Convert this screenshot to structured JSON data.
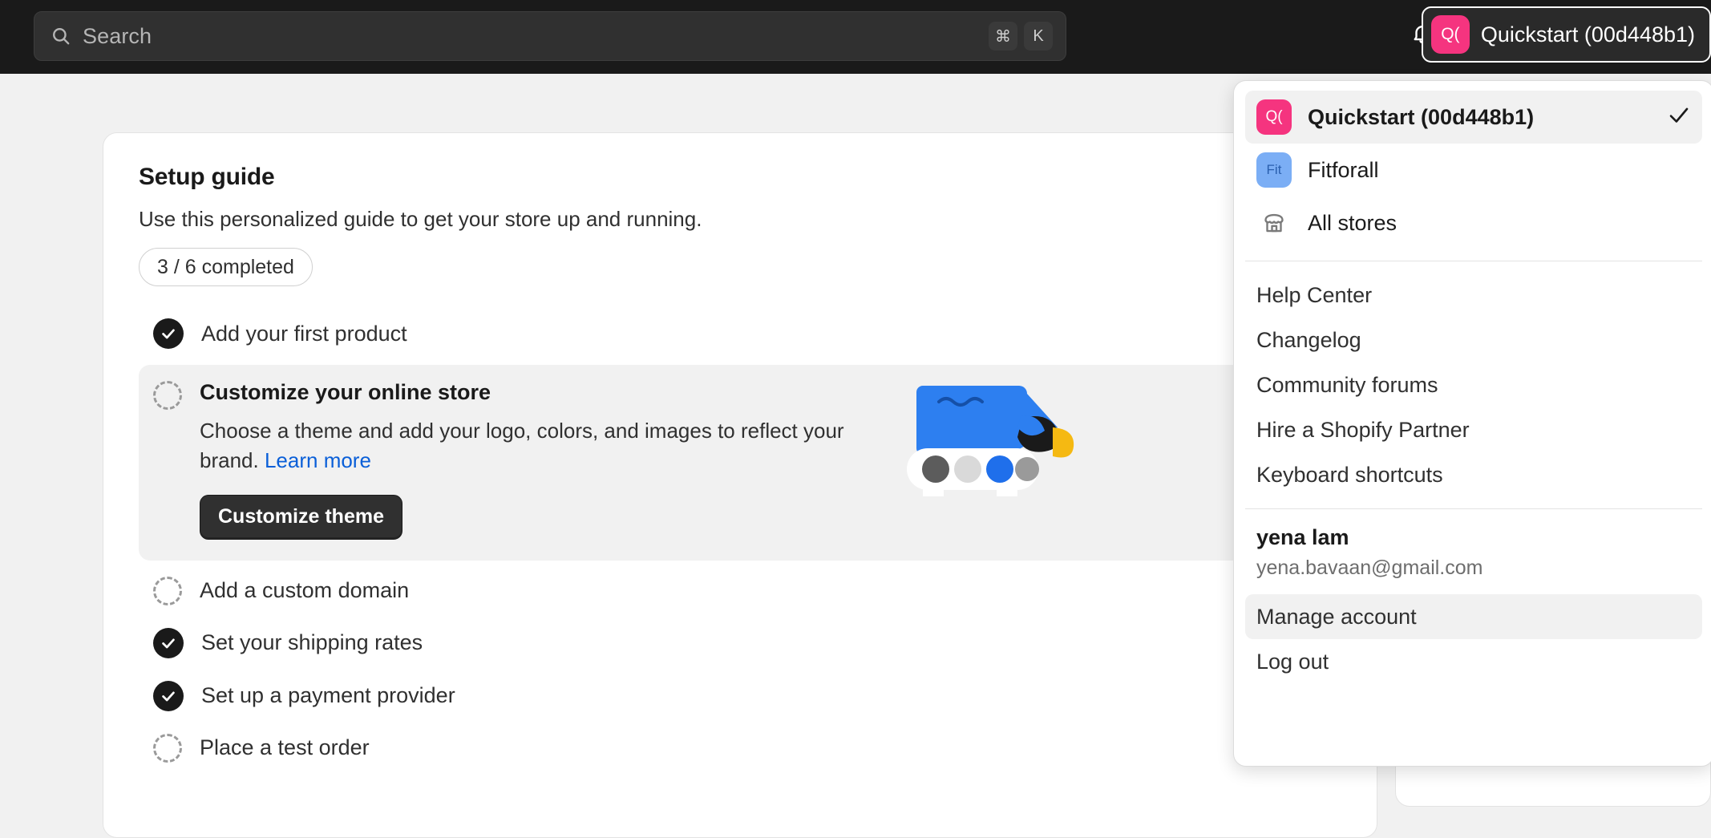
{
  "topbar": {
    "search": {
      "placeholder": "Search",
      "icon": "search-icon",
      "shortcut_keys": [
        "⌘",
        "K"
      ]
    },
    "notifications_icon": "bell-icon",
    "store_switcher": {
      "avatar_initials": "Q(",
      "label": "Quickstart (00d448b1)",
      "avatar_color": "#f5347f"
    },
    "background": "#1a1a1a"
  },
  "setup_guide": {
    "title": "Setup guide",
    "subtitle": "Use this personalized guide to get your store up and running.",
    "progress_label": "3 / 6 completed",
    "tasks": [
      {
        "label": "Add your first product",
        "done": true
      },
      {
        "label": "Customize your online store",
        "done": false
      },
      {
        "label": "Add a custom domain",
        "done": false
      },
      {
        "label": "Set your shipping rates",
        "done": true
      },
      {
        "label": "Set up a payment provider",
        "done": true
      },
      {
        "label": "Place a test order",
        "done": false
      }
    ],
    "active_task": {
      "title": "Customize your online store",
      "description": "Choose a theme and add your logo, colors, and images to reflect your brand.",
      "learn_more_label": "Learn more",
      "button_label": "Customize theme",
      "illustration_swatches": [
        "#5c5c5c",
        "#d9d9d9",
        "#1f6feb",
        "#9a9a9a"
      ]
    }
  },
  "account_menu": {
    "stores": [
      {
        "name": "Quickstart (00d448b1)",
        "initials": "Q(",
        "color": "#f5347f",
        "selected": true
      },
      {
        "name": "Fitforall",
        "initials": "Fit",
        "color": "#7baef5",
        "selected": false
      }
    ],
    "all_stores_label": "All stores",
    "all_stores_icon": "store-icon",
    "links": [
      "Help Center",
      "Changelog",
      "Community forums",
      "Hire a Shopify Partner",
      "Keyboard shortcuts"
    ],
    "user": {
      "name": "yena lam",
      "email": "yena.bavaan@gmail.com"
    },
    "manage_account_label": "Manage account",
    "log_out_label": "Log out",
    "checkmark_icon": "check-icon"
  }
}
